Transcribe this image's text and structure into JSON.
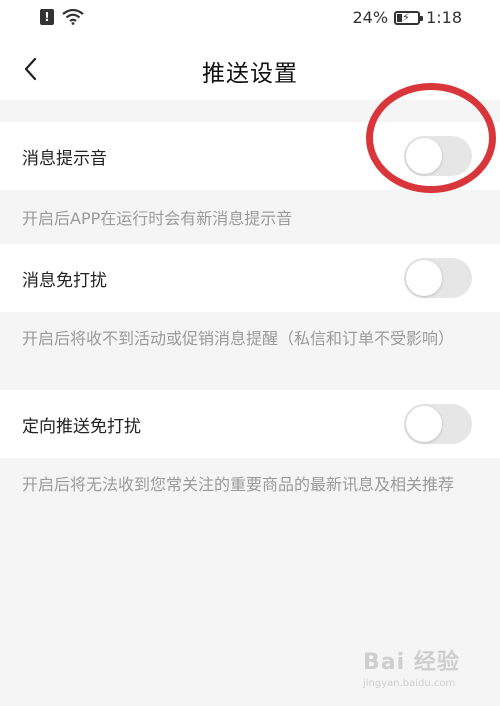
{
  "statusbar": {
    "alert_glyph": "!",
    "battery": "24%",
    "time": "1:18"
  },
  "header": {
    "title": "推送设置"
  },
  "settings": [
    {
      "label": "消息提示音",
      "description": "开启后APP在运行时会有新消息提示音",
      "enabled": false
    },
    {
      "label": "消息免打扰",
      "description": "开启后将收不到活动或促销消息提醒（私信和订单不受影响）",
      "enabled": false
    },
    {
      "label": "定向推送免打扰",
      "description": "开启后将无法收到您常关注的重要商品的最新讯息及相关推荐",
      "enabled": false
    }
  ],
  "watermark": {
    "logo": "Bai 经验",
    "url": "jingyan.baidu.com"
  },
  "colors": {
    "annotation": "#d9363b",
    "toggle_off": "#e6e6e6",
    "background": "#f5f5f5"
  }
}
